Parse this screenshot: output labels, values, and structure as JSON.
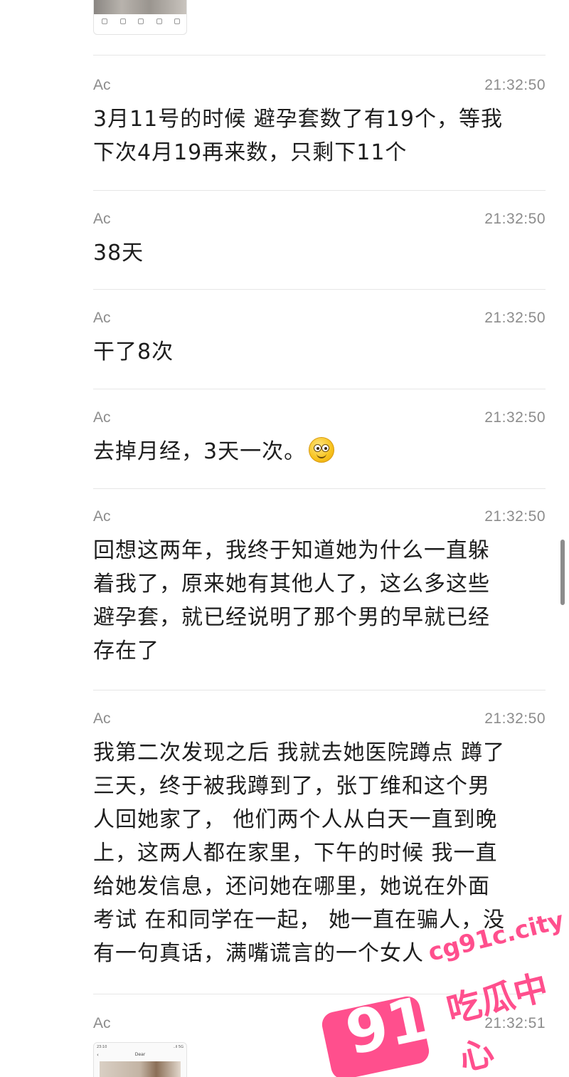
{
  "top_thumbnail": {
    "icon_names": [
      "home-icon",
      "folder-icon",
      "heart-icon",
      "save-icon",
      "share-icon"
    ]
  },
  "messages": [
    {
      "sender": "Ac",
      "time": "21:32:50",
      "text": "3月11号的时候 避孕套数了有19个，等我\n下次4月19再来数，只剩下11个"
    },
    {
      "sender": "Ac",
      "time": "21:32:50",
      "text": "38天"
    },
    {
      "sender": "Ac",
      "time": "21:32:50",
      "text": "干了8次"
    },
    {
      "sender": "Ac",
      "time": "21:32:50",
      "text": "去掉月经，3天一次。",
      "emoji": "smiley-emoji"
    },
    {
      "sender": "Ac",
      "time": "21:32:50",
      "text": "回想这两年，我终于知道她为什么一直躲\n着我了，原来她有其他人了，这么多这些\n避孕套，就已经说明了那个男的早就已经\n存在了"
    },
    {
      "sender": "Ac",
      "time": "21:32:50",
      "text": "我第二次发现之后 我就去她医院蹲点 蹲了\n三天，终于被我蹲到了，张丁维和这个男\n人回她家了， 他们两个人从白天一直到晚\n上，这两人都在家里，下午的时候 我一直\n给她发信息，还问她在哪里，她说在外面\n考试 在和同学在一起， 她一直在骗人，没\n有一句真话，满嘴谎言的一个女人"
    },
    {
      "sender": "Ac",
      "time": "21:32:51",
      "text": ""
    }
  ],
  "bottom_thumbnail": {
    "title": "Dear",
    "status_left": "23:10",
    "status_right": "..il 5G"
  },
  "watermark": {
    "url": "cg91c.city",
    "number": "91",
    "label": "吃瓜中心",
    "color": "#ff4f8d"
  }
}
